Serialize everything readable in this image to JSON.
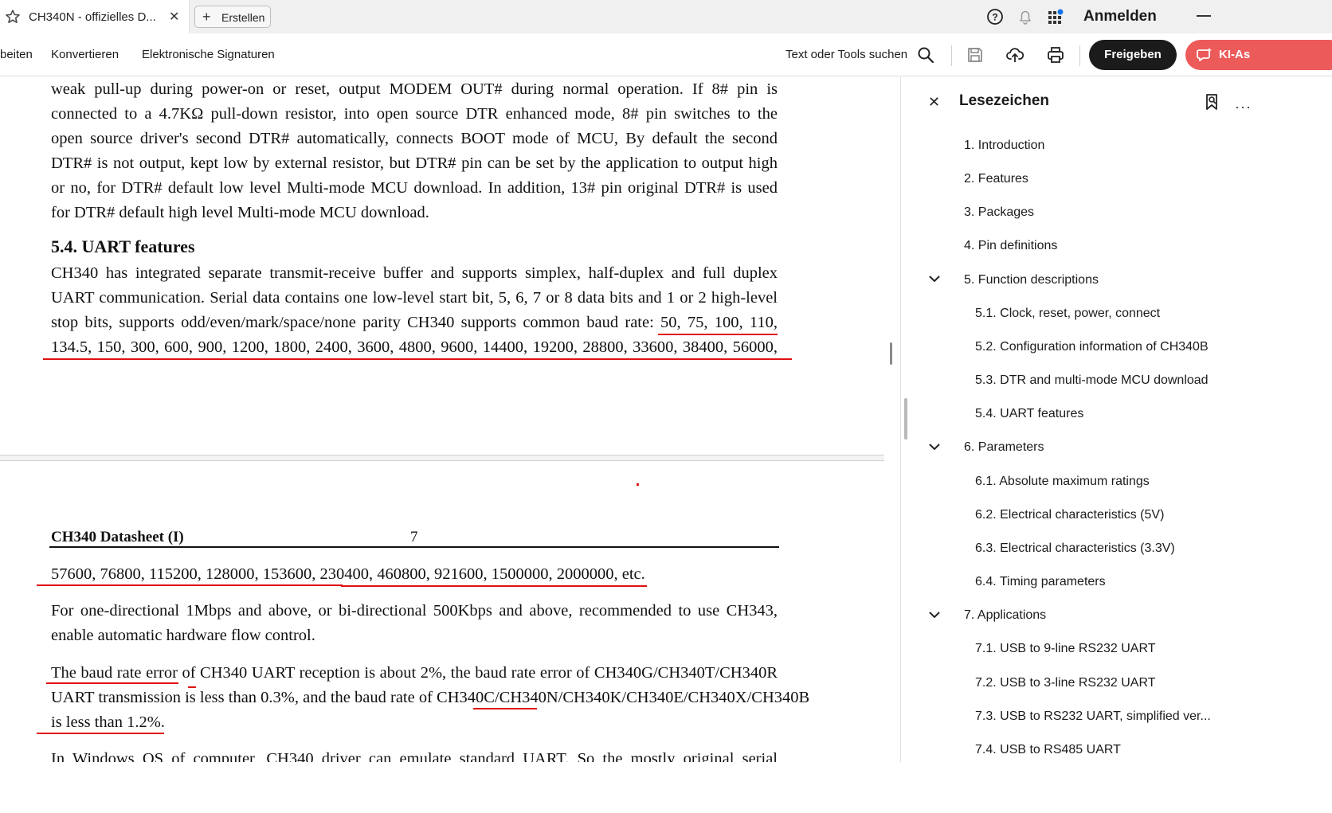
{
  "tab": {
    "title": "CH340N - offizielles D...",
    "new_button": "Erstellen"
  },
  "topbar": {
    "signin": "Anmelden"
  },
  "toolbar": {
    "menu": [
      "beiten",
      "Konvertieren",
      "Elektronische Signaturen"
    ],
    "search_label": "Text oder Tools suchen",
    "share": "Freigeben",
    "ai": "KI-As"
  },
  "document": {
    "para1": [
      "weak pull-up during power-on or reset, output MODEM OUT# during normal operation. If 8# pin is",
      "connected to a 4.7KΩ  pull-down resistor, into open source DTR enhanced mode, 8# pin switches to the",
      "open source driver's second DTR# automatically, connects BOOT mode of MCU, By default the second",
      "DTR# is not output, kept low by external resistor, but DTR# pin can be set by the application to output high",
      "or no, for DTR# default low level Multi-mode MCU download. In addition, 13# pin original DTR# is used",
      "for DTR# default high level Multi-mode MCU download."
    ],
    "section_heading": "5.4. UART features",
    "para2": [
      "CH340 has integrated separate transmit-receive buffer and supports simplex, half-duplex and full duplex",
      "UART communication. Serial data contains one low-level start bit, 5, 6, 7 or 8 data bits and 1 or 2 high-level",
      "stop bits, supports odd/even/mark/space/none parity CH340 supports common baud rate: 50, 75, 100, 110,",
      "134.5, 150, 300, 600, 900, 1200, 1800, 2400, 3600, 4800, 9600, 14400, 19200, 28800, 33600, 38400, 56000,"
    ],
    "page_header_title": "CH340 Datasheet (I)",
    "page_number": "7",
    "para3": "57600, 76800, 115200, 128000, 153600, 230400, 460800, 921600, 1500000, 2000000, etc.",
    "para4": [
      "For one-directional 1Mbps and above, or bi-directional 500Kbps and above, recommended to use CH343,",
      "enable automatic hardware flow control."
    ],
    "para5": [
      "The baud rate error of CH340 UART reception is about 2%, the baud rate error of CH340G/CH340T/CH340R",
      "UART transmission is less than 0.3%, and the baud rate of CH340C/CH340N/CH340K/CH340E/CH340X/CH340B",
      "is less than 1.2%."
    ],
    "para6": "In Windows OS of computer, CH340 driver can emulate standard UART. So the mostly original serial"
  },
  "bookmarks": {
    "title": "Lesezeichen",
    "items": [
      {
        "label": "1. Introduction"
      },
      {
        "label": "2. Features"
      },
      {
        "label": "3. Packages"
      },
      {
        "label": "4. Pin definitions"
      },
      {
        "label": "5. Function descriptions"
      },
      {
        "label": "5.1. Clock, reset, power, connect"
      },
      {
        "label": "5.2. Configuration information of CH340B"
      },
      {
        "label": "5.3. DTR and multi-mode MCU download"
      },
      {
        "label": "5.4. UART features"
      },
      {
        "label": "6. Parameters"
      },
      {
        "label": "6.1. Absolute maximum ratings"
      },
      {
        "label": "6.2. Electrical characteristics (5V)"
      },
      {
        "label": "6.3. Electrical characteristics (3.3V)"
      },
      {
        "label": "6.4. Timing parameters"
      },
      {
        "label": "7. Applications"
      },
      {
        "label": "7.1. USB to 9-line RS232 UART"
      },
      {
        "label": "7.2. USB to 3-line RS232 UART"
      },
      {
        "label": "7.3. USB to RS232 UART, simplified ver..."
      },
      {
        "label": "7.4. USB to RS485 UART"
      }
    ]
  },
  "colors": {
    "annotation_red": "#e01010",
    "share_bg": "#1b1b1b",
    "ai_bg": "#ec5a5a"
  },
  "icons": [
    "star-icon",
    "close-icon",
    "plus-icon",
    "help-icon",
    "bell-icon",
    "apps-icon",
    "search-icon",
    "save-icon",
    "upload-icon",
    "print-icon",
    "ai-assistant-icon",
    "bookmark-add-icon",
    "more-icon",
    "chevron-down-icon"
  ]
}
